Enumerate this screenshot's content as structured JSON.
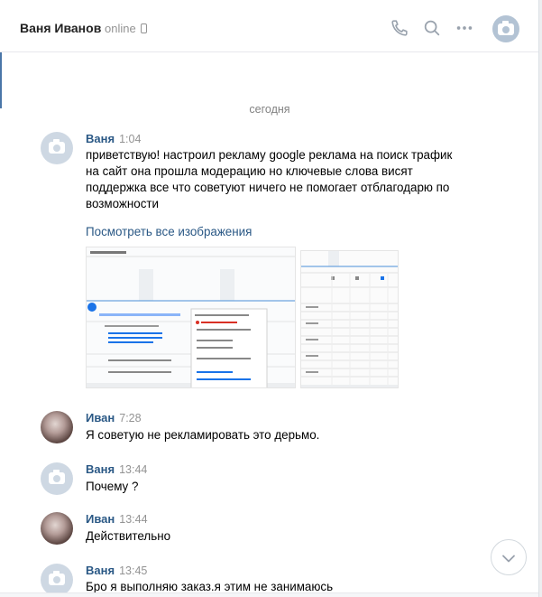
{
  "header": {
    "name": "Ваня Иванов",
    "status": "online"
  },
  "date_separator": "сегодня",
  "messages": [
    {
      "author": "Ваня",
      "time": "1:04",
      "text": "приветствую! настроил рекламу google реклама на поиск трафик на сайт она прошла модерацию но ключевые слова висят поддержка все что советуют ничего не помогает отблагодарю по возможности",
      "view_all": "Посмотреть все изображения"
    },
    {
      "author": "Иван",
      "time": "7:28",
      "text": "Я советую не рекламировать это дерьмо."
    },
    {
      "author": "Ваня",
      "time": "13:44",
      "text": "Почему ?"
    },
    {
      "author": "Иван",
      "time": "13:44",
      "text": "Действительно"
    },
    {
      "author": "Ваня",
      "time": "13:45",
      "text": "Бро я выполняю заказ.я этим не занимаюсь"
    }
  ],
  "colors": {
    "link": "#2a5885",
    "muted": "#939393",
    "accent": "#4a76a8"
  },
  "icons": [
    "phone-icon",
    "search-icon",
    "more-icon",
    "camera-icon",
    "chevron-down-icon"
  ]
}
